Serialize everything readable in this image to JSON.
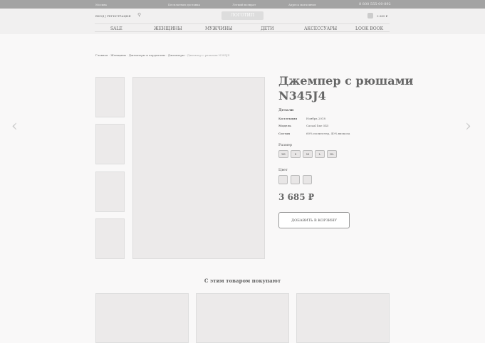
{
  "topbar": {
    "city": "Москва",
    "delivery": "Бесплатная доставка",
    "returns": "Легкий возврат",
    "stores": "Адреса магазинов",
    "phone": "8 800 555-00-892"
  },
  "header": {
    "login": "ВХОД | РЕГИСТРАЦИЯ",
    "logo": "ЛОГОТИП",
    "cart_total": "3 685 ₽"
  },
  "nav": [
    "SALE",
    "ЖЕНЩИНЫ",
    "МУЖЧИНЫ",
    "ДЕТИ",
    "АКСЕССУАРЫ",
    "LOOK BOOK"
  ],
  "breadcrumbs": {
    "path": "Главная · Женщины · Джемперы и кардиганы · Джемперы · ",
    "current": "Джемпер с рюшами N345J4"
  },
  "product": {
    "title_line1": "Джемпер с рюшами",
    "title_line2": "N345J4",
    "details_heading": "Детали",
    "details": [
      {
        "k": "Коллекция",
        "v": "Ноябрь 2018"
      },
      {
        "k": "Модель",
        "v": "Casual line 545"
      },
      {
        "k": "Состав",
        "v": "60% полиэстер, 40% вискоза"
      }
    ],
    "size_label": "Размер",
    "sizes": [
      "XS",
      "S",
      "M",
      "L",
      "XL"
    ],
    "color_label": "Цвет",
    "price": "3 685 ₽",
    "add_to_cart": "ДОБАВИТЬ В КОРЗИНУ"
  },
  "related": {
    "heading": "С этим товаром покупают"
  },
  "arrows": {
    "prev": "‹",
    "next": "›"
  }
}
